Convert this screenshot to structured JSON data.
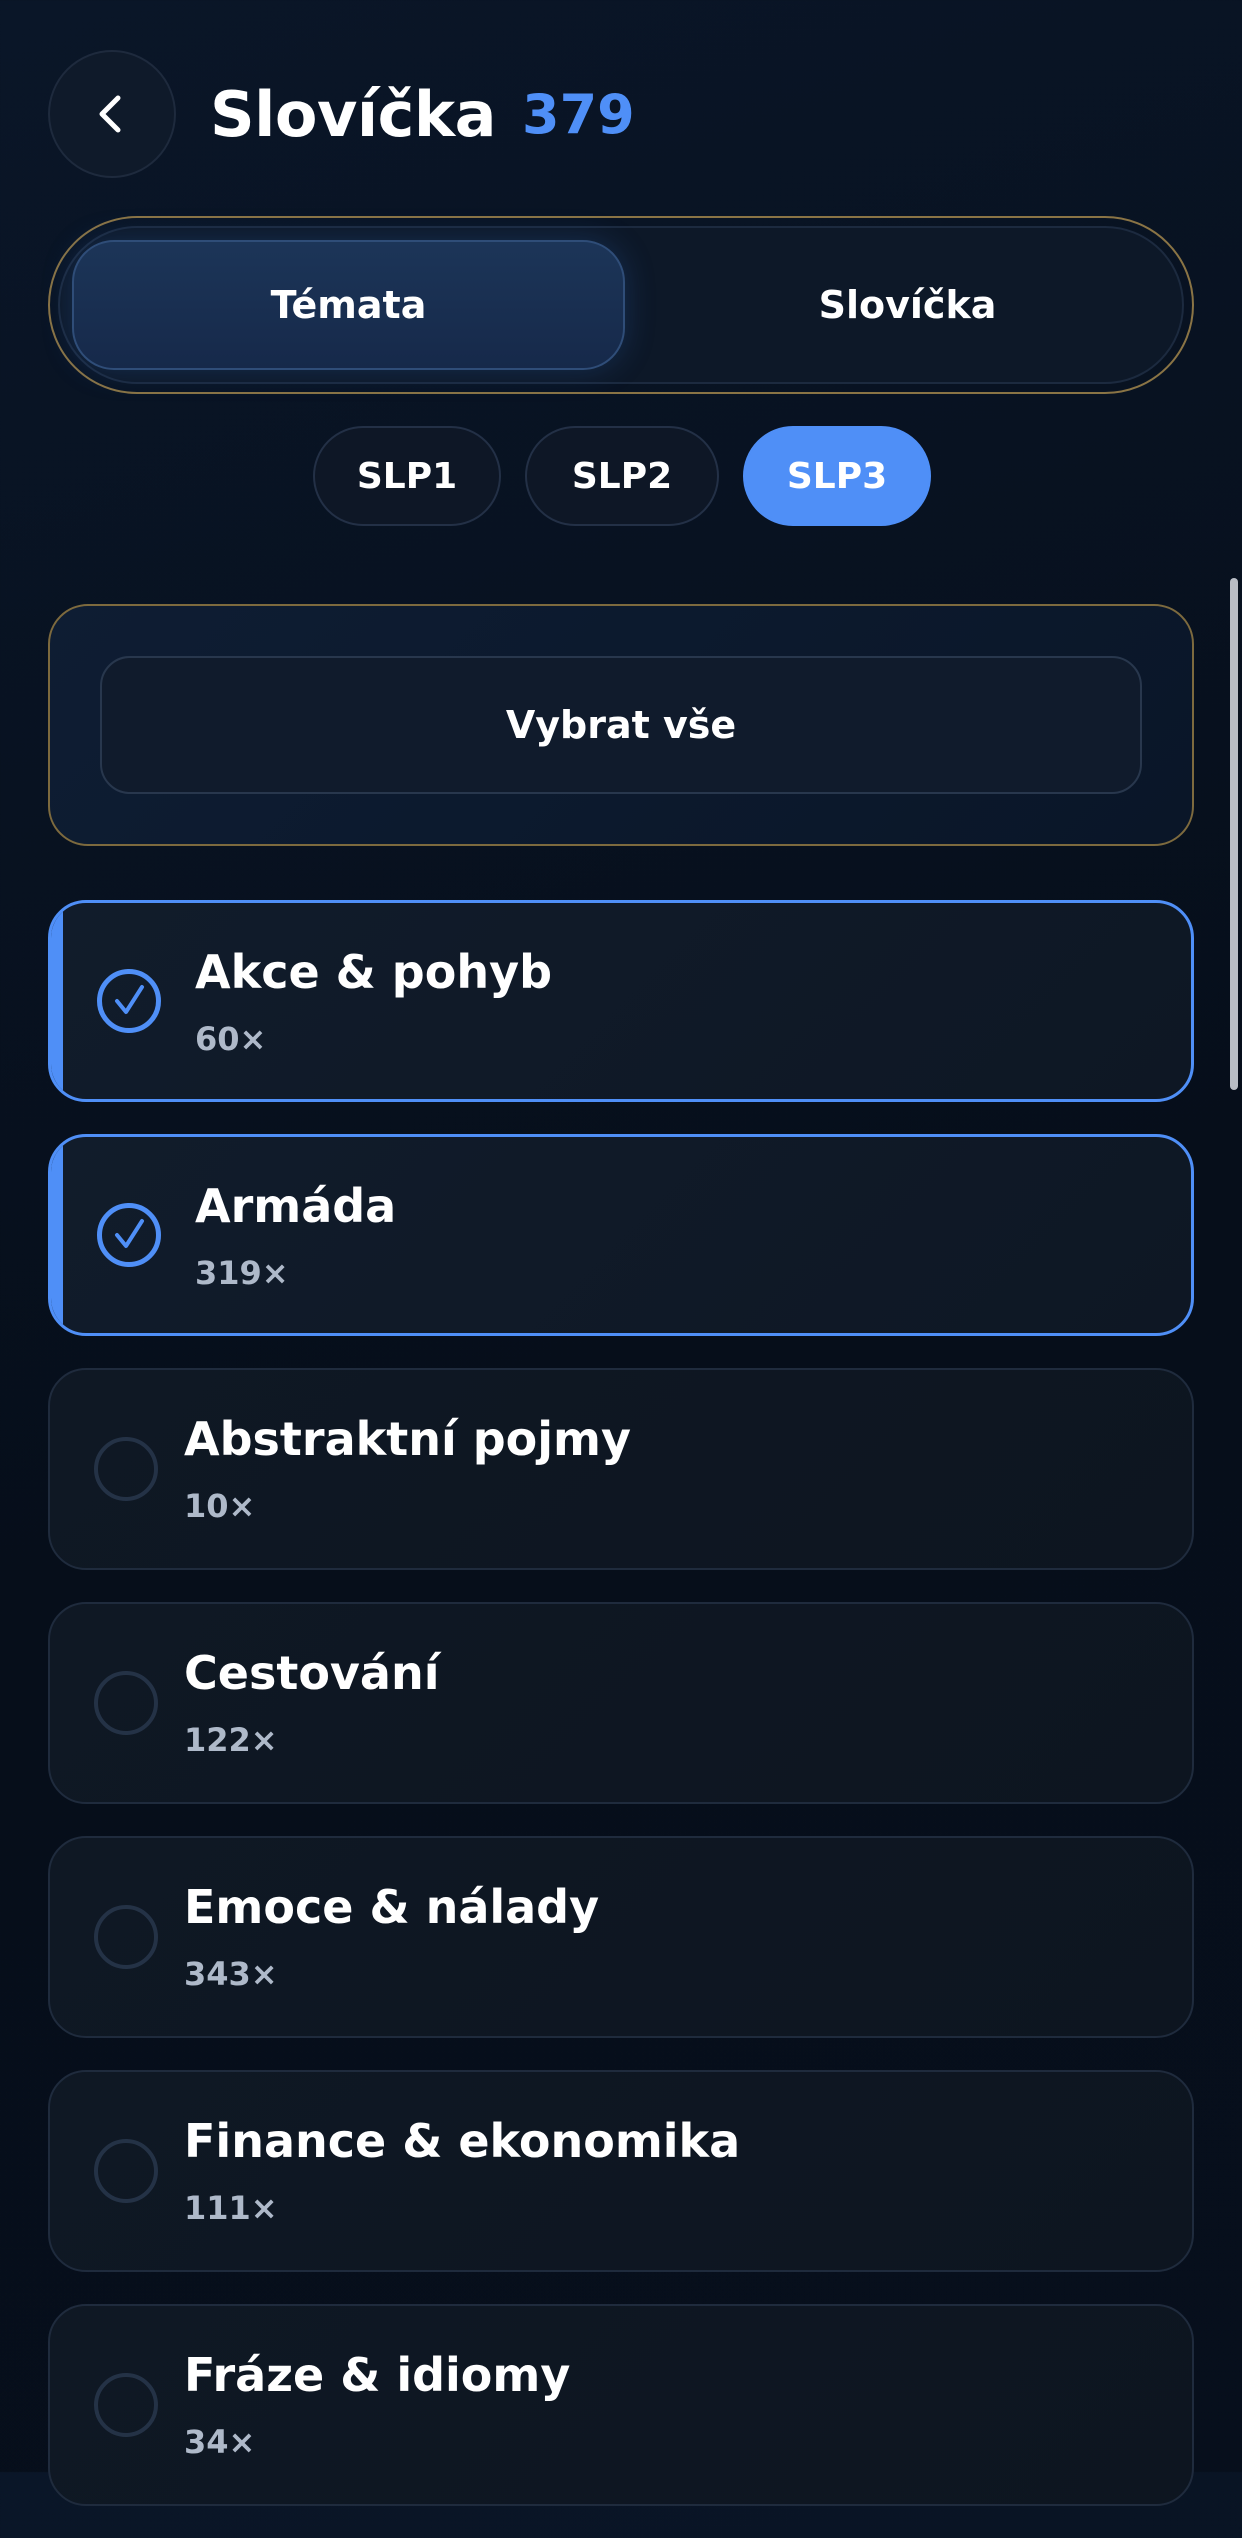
{
  "header": {
    "title": "Slovíčka",
    "count": "379"
  },
  "tabs": [
    {
      "label": "Témata",
      "active": true
    },
    {
      "label": "Slovíčka",
      "active": false
    }
  ],
  "levels": [
    {
      "label": "SLP1",
      "active": false
    },
    {
      "label": "SLP2",
      "active": false
    },
    {
      "label": "SLP3",
      "active": true
    }
  ],
  "select_all": {
    "label": "Vybrat vše"
  },
  "topics": [
    {
      "name": "Akce & pohyb",
      "count": "60×",
      "selected": true
    },
    {
      "name": "Armáda",
      "count": "319×",
      "selected": true
    },
    {
      "name": "Abstraktní pojmy",
      "count": "10×",
      "selected": false
    },
    {
      "name": "Cestování",
      "count": "122×",
      "selected": false
    },
    {
      "name": "Emoce & nálady",
      "count": "343×",
      "selected": false
    },
    {
      "name": "Finance & ekonomika",
      "count": "111×",
      "selected": false
    },
    {
      "name": "Fráze & idiomy",
      "count": "34×",
      "selected": false
    }
  ],
  "colors": {
    "accent": "#4f8ff7",
    "background": "#0a1628",
    "gold_border": "#8a7445"
  },
  "icons": {
    "back": "chevron-left-icon",
    "checked": "check-circle-icon",
    "unchecked": "empty-circle-icon"
  }
}
